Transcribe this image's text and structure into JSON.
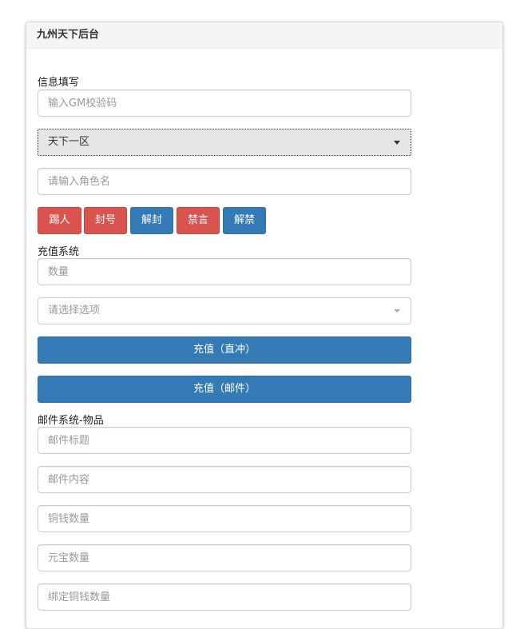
{
  "panel": {
    "title": "九州天下后台"
  },
  "info": {
    "label": "信息填写",
    "gm_code_placeholder": "输入GM校验码",
    "server_selected": "天下一区",
    "role_placeholder": "请输入角色名",
    "buttons": {
      "kick": "踢人",
      "ban": "封号",
      "unban": "解封",
      "mute": "禁言",
      "unmute": "解禁"
    }
  },
  "recharge": {
    "label": "充值系统",
    "amount_placeholder": "数量",
    "option_placeholder": "请选择选项",
    "direct_button": "充值（直冲）",
    "mail_button": "充值（邮件）"
  },
  "mail": {
    "label": "邮件系统-物品",
    "title_placeholder": "邮件标题",
    "content_placeholder": "邮件内容",
    "copper_placeholder": "铜钱数量",
    "ingot_placeholder": "元宝数量",
    "bound_copper_placeholder": "绑定铜钱数量"
  },
  "colors": {
    "danger": "#d9534f",
    "primary": "#337ab7"
  }
}
